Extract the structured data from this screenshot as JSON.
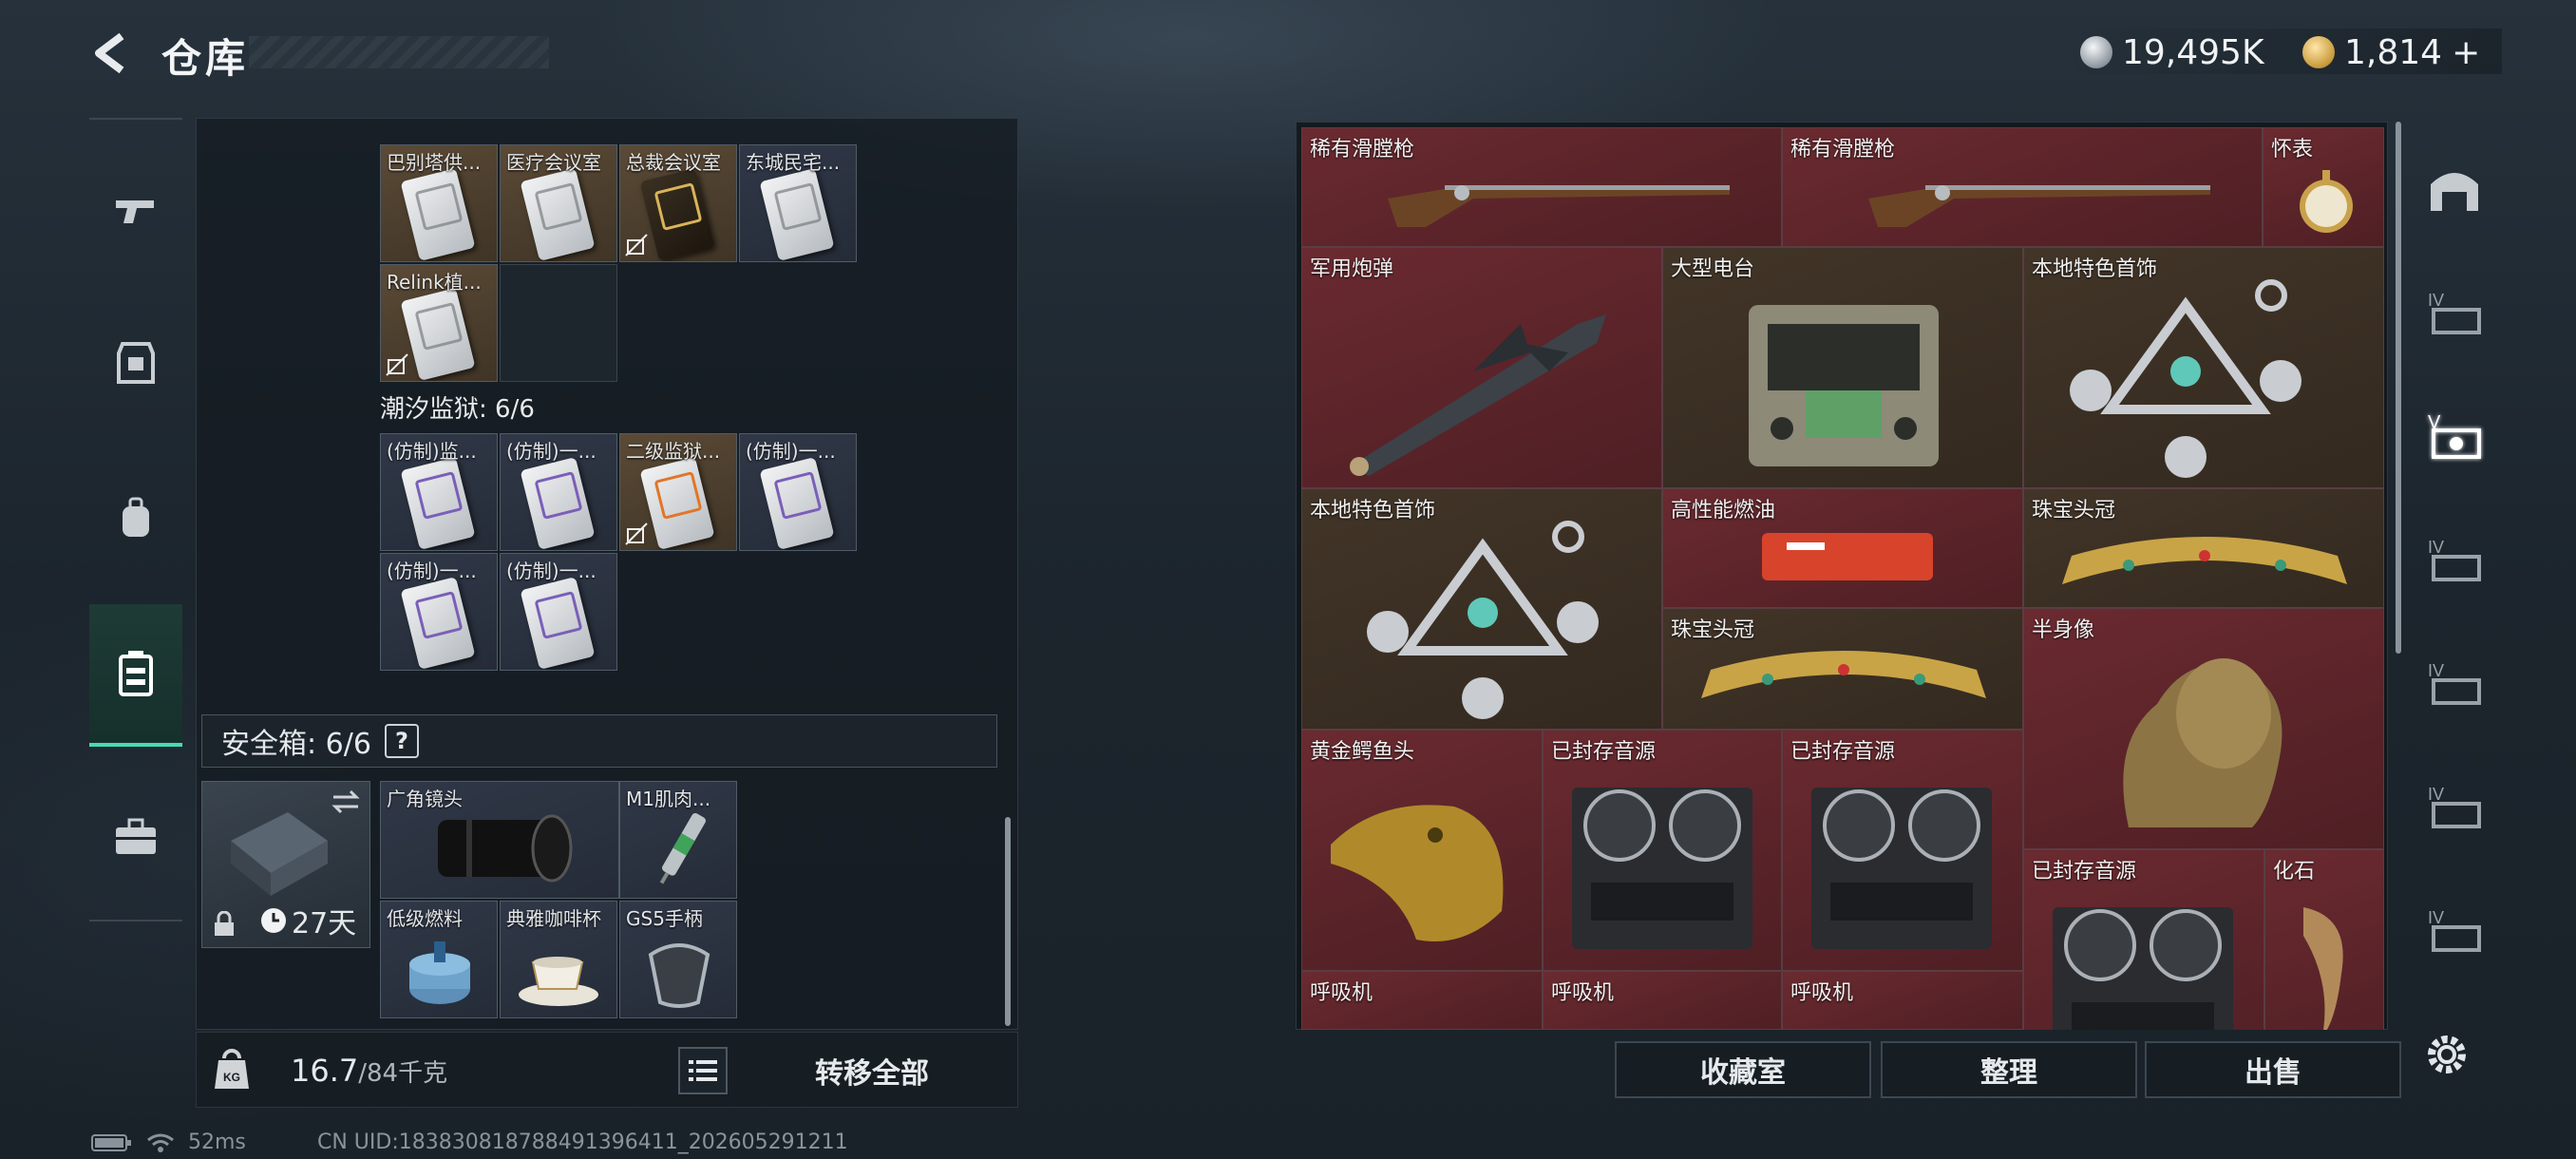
{
  "header": {
    "title": "仓库",
    "currency_silver": "19,495K",
    "currency_gold": "1,814",
    "currency_gold_plus": "+"
  },
  "left_nav": {
    "items": [
      "weapons",
      "armor",
      "backpack",
      "storage",
      "toolbox"
    ],
    "active": "storage"
  },
  "storage": {
    "cards_top": [
      {
        "label": "巴别塔供...",
        "style": "tan"
      },
      {
        "label": "医疗会议室",
        "style": "tan"
      },
      {
        "label": "总裁会议室",
        "style": "tan",
        "card": "gold"
      },
      {
        "label": "东城民宅...",
        "style": "blue"
      },
      {
        "label": "Relink植...",
        "style": "tan"
      }
    ],
    "tide_prison_title": "潮汐监狱: 6/6",
    "cards_prison": [
      {
        "label": "(仿制)监...",
        "card": "purple"
      },
      {
        "label": "(仿制)一...",
        "card": "purple"
      },
      {
        "label": "二级监狱...",
        "card": "orange"
      },
      {
        "label": "(仿制)一...",
        "card": "purple"
      },
      {
        "label": "(仿制)一...",
        "card": "purple"
      },
      {
        "label": "(仿制)一...",
        "card": "purple"
      }
    ]
  },
  "safebox": {
    "title": "安全箱:  6/6",
    "help": "?",
    "days": "27天",
    "items": [
      {
        "label": "广角镜头"
      },
      {
        "label": "M1肌肉..."
      },
      {
        "label": "低级燃料"
      },
      {
        "label": "典雅咖啡杯"
      },
      {
        "label": "GS5手柄"
      }
    ]
  },
  "bottom": {
    "weight_current": "16.7",
    "weight_total": "/84千克",
    "transfer_all": "转移全部"
  },
  "grid_items": [
    {
      "label": "稀有滑膛枪",
      "color": "red"
    },
    {
      "label": "稀有滑膛枪",
      "color": "red"
    },
    {
      "label": "怀表",
      "color": "red"
    },
    {
      "label": "军用炮弹",
      "color": "red"
    },
    {
      "label": "大型电台",
      "color": "brown"
    },
    {
      "label": "本地特色首饰",
      "color": "brown"
    },
    {
      "label": "本地特色首饰",
      "color": "brown"
    },
    {
      "label": "高性能燃油",
      "color": "red"
    },
    {
      "label": "珠宝头冠",
      "color": "brown"
    },
    {
      "label": "珠宝头冠",
      "color": "brown"
    },
    {
      "label": "半身像",
      "color": "red"
    },
    {
      "label": "黄金鳄鱼头",
      "color": "red"
    },
    {
      "label": "已封存音源",
      "color": "red"
    },
    {
      "label": "已封存音源",
      "color": "red"
    },
    {
      "label": "已封存音源",
      "color": "red"
    },
    {
      "label": "化石",
      "color": "red"
    },
    {
      "label": "呼吸机",
      "color": "red"
    },
    {
      "label": "呼吸机",
      "color": "red"
    },
    {
      "label": "呼吸机",
      "color": "red"
    }
  ],
  "actions": {
    "collection_room": "收藏室",
    "organize": "整理",
    "sell": "出售"
  },
  "status_bar": {
    "ping": "52ms",
    "uid": "CN UID:1838308187884913964​11_202605291211"
  }
}
